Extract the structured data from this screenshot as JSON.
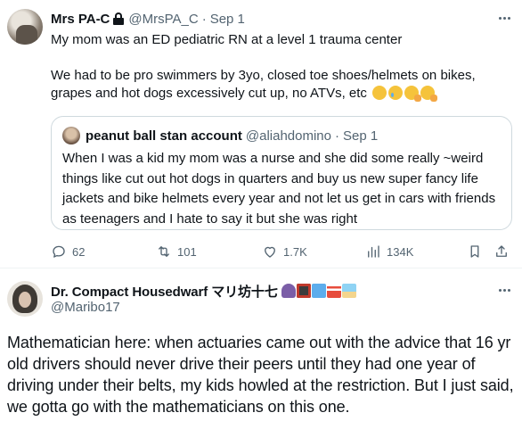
{
  "tweet1": {
    "name": "Mrs PA-C",
    "handle": "@MrsPA_C",
    "separator": "·",
    "date": "Sep 1",
    "paragraphs": [
      "My mom was an ED pediatric RN at a level 1 trauma center",
      "We had to be pro swimmers by 3yo, closed toe shoes/helmets on bikes, grapes and hot dogs excessively cut up, no ATVs, etc"
    ],
    "emojis": [
      "slightly-smiling-face",
      "smiling-face-with-tear",
      "saluting-face",
      "saluting-face"
    ],
    "quoted": {
      "name": "peanut ball stan account",
      "handle": "@aliahdomino",
      "separator": "·",
      "date": "Sep 1",
      "text": "When I was a kid my mom was a nurse and she did some really ~weird things like cut out hot dogs in quarters and buy us new super fancy life jackets and bike helmets every year and not let us get in cars with friends as teenagers and I hate to say it but she was right"
    },
    "actions": {
      "replies": "62",
      "retweets": "101",
      "likes": "1.7K",
      "views": "134K"
    }
  },
  "tweet2": {
    "name": "Dr. Compact Housedwarf マリ坊十七",
    "handle": "@Maribo17",
    "name_emojis": [
      "woman-tipping-hand",
      "bento-box",
      "japan-map",
      "torii-gate",
      "desert-island"
    ],
    "text": "Mathematician here: when actuaries came out with the advice that 16 yr old drivers should never drive their peers until they had one year of driving under their belts, my kids howled at the restriction. But I just said, we gotta go with the mathematicians on this one."
  },
  "colors": {
    "text": "#0f1419",
    "muted": "#536471",
    "border": "#cfd9de"
  }
}
